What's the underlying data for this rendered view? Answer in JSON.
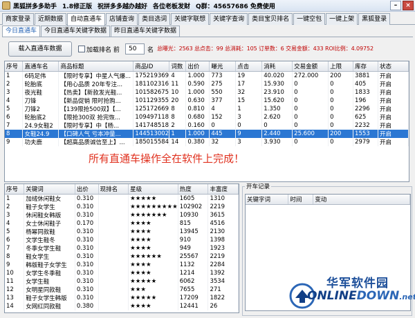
{
  "window": {
    "title": "黑狐拼多多助手",
    "version": "1.8修正版",
    "slogan": "祝拼多多越办越好",
    "contact": "各位老板发财",
    "qq_group": "Q群：45657686 免费使用"
  },
  "main_tabs": [
    "商家登录",
    "近期数据",
    "自动直通车",
    "店铺查询",
    "类目选词",
    "关键字联想",
    "关键字查询",
    "类目宝贝排名",
    "一键空包",
    "一键上架",
    "黑狐登录"
  ],
  "sub_tabs": [
    "今日直通车",
    "今日直通车关键字数据",
    "昨日直通车关键字数据"
  ],
  "toolbar": {
    "load_label": "载入直通车数据",
    "rank_label": "加载排名 前",
    "rank_value": "50",
    "rank_unit": "名",
    "stats": "总曝光：2563  总点击：99  总消耗：105  订单数：6  交易金额：433  ROI比例：4.09752"
  },
  "main_table": {
    "columns": [
      "序号",
      "直通车名",
      "商品标题",
      "商品ID",
      "词数",
      "出价",
      "曝光",
      "点击",
      "消耗",
      "交易金额",
      "上限",
      "库存",
      "状态"
    ],
    "rows": [
      [
        "1",
        "6码足伟",
        "【限时专享】中星人气爆...",
        "175219369",
        "4",
        "1.000",
        "773",
        "19",
        "40.020",
        "272.000",
        "200",
        "3881",
        "开启"
      ],
      [
        "2",
        "轮胎底",
        "【用心品质 20年专注...",
        "181102316",
        "11",
        "0.590",
        "275",
        "17",
        "15.930",
        "0",
        "0",
        "405",
        "开启"
      ],
      [
        "3",
        "夜光鞋",
        "【热卖】【新款发光鞋...",
        "101582675",
        "10",
        "1.000",
        "550",
        "32",
        "23.910",
        "0",
        "0",
        "1833",
        "开启"
      ],
      [
        "4",
        "刀锋",
        "【新品促销 限时抢购...",
        "101129355",
        "20",
        "0.630",
        "377",
        "15",
        "15.620",
        "0",
        "0",
        "196",
        "开启"
      ],
      [
        "5",
        "刀锋2",
        "【139限抢500双】【...",
        "125172669",
        "8",
        "0.810",
        "4",
        "1",
        "1.350",
        "0",
        "0",
        "2296",
        "开启"
      ],
      [
        "6",
        "轮胎底2",
        "【限抢300双 抢完恢...",
        "109497118",
        "8",
        "0.680",
        "152",
        "3",
        "2.620",
        "0",
        "0",
        "625",
        "开启"
      ],
      [
        "7",
        "24.9女鞋2",
        "【限时专享】中【杨...",
        "141748518",
        "2",
        "0.160",
        "0",
        "0",
        "0",
        "0",
        "0",
        "2232",
        "开启"
      ],
      [
        "8",
        "女鞋24.9",
        "【口碑人气 亏本冲量...",
        "144513002",
        "1",
        "1.000",
        "445",
        "9",
        "2.440",
        "25.600",
        "200",
        "1553",
        "开启"
      ],
      [
        "9",
        "功夫鹿",
        "【超高品质诚信至上】...",
        "185015584",
        "14",
        "0.380",
        "32",
        "3",
        "3.930",
        "0",
        "0",
        "2979",
        "开启"
      ]
    ]
  },
  "overlay_message": "所有直通车操作全在软件上完成！",
  "keyword_table": {
    "columns": [
      "序号",
      "关键词",
      "出价",
      "现排名",
      "星级",
      "热度",
      "丰富度"
    ],
    "rows": [
      [
        "1",
        "加绒休闲鞋女",
        "0.310",
        "",
        "★★★★★",
        "1605",
        "1310"
      ],
      [
        "2",
        "鞋子女学生",
        "0.310",
        "",
        "★★★★★★★★★",
        "102902",
        "2219"
      ],
      [
        "3",
        "休闲鞋女韩版",
        "0.310",
        "",
        "★★★★★★★",
        "10930",
        "3615"
      ],
      [
        "4",
        "女士休闲鞋子",
        "0.170",
        "",
        "★★★★",
        "815",
        "4516"
      ],
      [
        "5",
        "杨幂同款鞋",
        "0.310",
        "",
        "★★★★",
        "13945",
        "2130"
      ],
      [
        "6",
        "文学生鞋冬",
        "0.310",
        "",
        "★★★★",
        "910",
        "1398"
      ],
      [
        "7",
        "冬季女学生鞋",
        "0.310",
        "",
        "★★★★",
        "949",
        "1923"
      ],
      [
        "8",
        "鞋女学生",
        "0.310",
        "",
        "★★★★★★",
        "25567",
        "2219"
      ],
      [
        "9",
        "韩版鞋子女学生",
        "0.310",
        "",
        "★★★★",
        "1132",
        "2284"
      ],
      [
        "10",
        "女学生冬季鞋",
        "0.310",
        "",
        "★★★★",
        "1214",
        "1392"
      ],
      [
        "11",
        "女学生鞋",
        "0.310",
        "",
        "★★★★★",
        "6062",
        "3534"
      ],
      [
        "12",
        "女明星同款鞋",
        "0.310",
        "",
        "★★★",
        "7655",
        "271"
      ],
      [
        "13",
        "鞋子女学生韩版",
        "0.310",
        "",
        "★★★★★",
        "17209",
        "1822"
      ],
      [
        "14",
        "女网红同款鞋",
        "0.380",
        "",
        "★★★★",
        "12441",
        "26"
      ]
    ]
  },
  "log_panel": {
    "title": "开车记录",
    "columns": [
      "关键字词",
      "时间",
      "变动"
    ]
  },
  "watermark": {
    "cn": "华军软件园",
    "en_prefix": "ONLINE",
    "en_suffix": "DOWN",
    "en_tld": ".net"
  },
  "colors": {
    "selection": "#2b77d3",
    "stats_red": "#c00000",
    "overlay_red": "#e0301e",
    "watermark_blue": "#1d4f9a"
  }
}
